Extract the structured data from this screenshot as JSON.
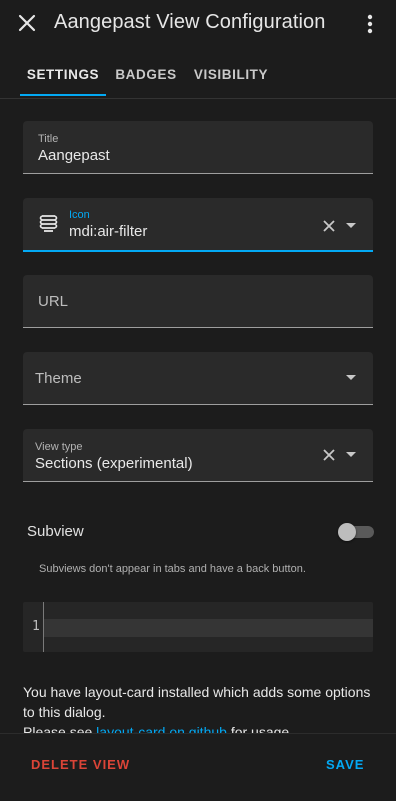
{
  "header": {
    "title": "Aangepast View Configuration",
    "close_icon": "close-icon",
    "menu_icon": "dots-vertical-icon"
  },
  "tabs": [
    {
      "label": "SETTINGS",
      "active": true
    },
    {
      "label": "BADGES",
      "active": false
    },
    {
      "label": "VISIBILITY",
      "active": false
    }
  ],
  "form": {
    "title_field": {
      "label": "Title",
      "value": "Aangepast"
    },
    "icon_field": {
      "label": "Icon",
      "value": "mdi:air-filter",
      "icon": "air-filter-icon"
    },
    "url_field": {
      "placeholder": "URL"
    },
    "theme_field": {
      "placeholder": "Theme"
    },
    "view_type_field": {
      "label": "View type",
      "value": "Sections (experimental)"
    },
    "subview": {
      "label": "Subview",
      "enabled": false,
      "helper": "Subviews don't appear in tabs and have a back button."
    }
  },
  "editor": {
    "line_number": "1"
  },
  "info": {
    "line1": "You have layout-card installed which adds some options to this dialog.",
    "line2_prefix": "Please see ",
    "link": "layout-card on github",
    "line2_suffix": " for usage"
  },
  "footer": {
    "delete_label": "DELETE VIEW",
    "save_label": "SAVE"
  },
  "colors": {
    "accent": "#03a9f4",
    "danger": "#db4437",
    "background": "#1c1c1c"
  }
}
